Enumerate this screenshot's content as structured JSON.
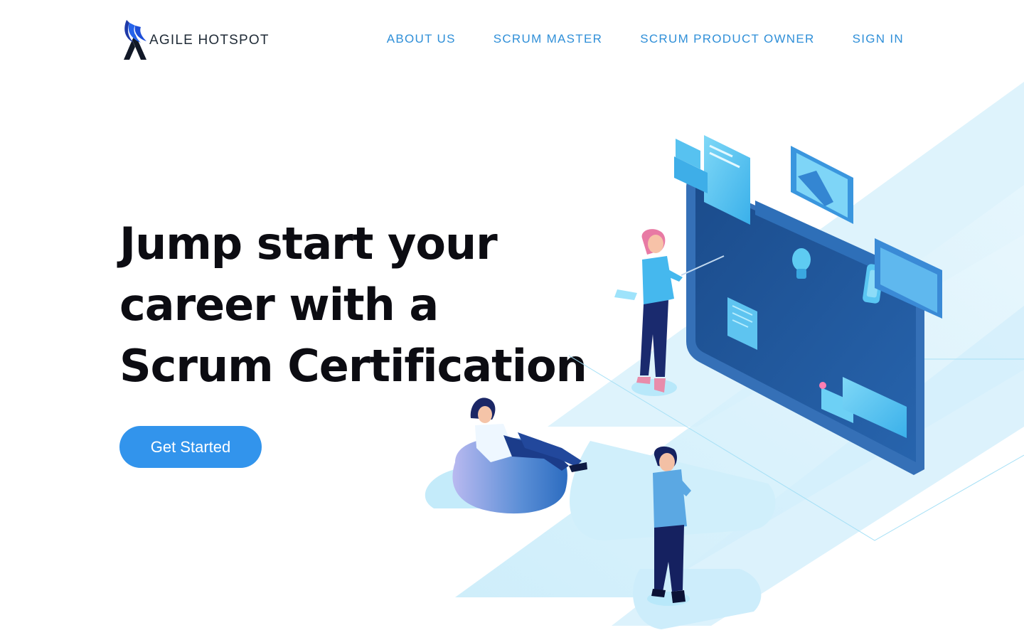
{
  "header": {
    "brand": "AGILE HOTSPOT",
    "nav": [
      {
        "label": "ABOUT US"
      },
      {
        "label": "SCRUM MASTER"
      },
      {
        "label": "SCRUM PRODUCT OWNER"
      },
      {
        "label": "SIGN IN"
      }
    ]
  },
  "hero": {
    "title_line1": "Jump start your",
    "title_line2": "career with a",
    "title_line3": "Scrum Certification",
    "cta_label": "Get Started"
  },
  "colors": {
    "accent": "#3294ec",
    "nav_text": "#2f8fd8",
    "heading": "#0c0c12",
    "board_dark": "#1e4f8f"
  },
  "icons": {
    "logo": "agile-hotspot-logo-icon",
    "illustration": "isometric-team-whiteboard-illustration"
  }
}
